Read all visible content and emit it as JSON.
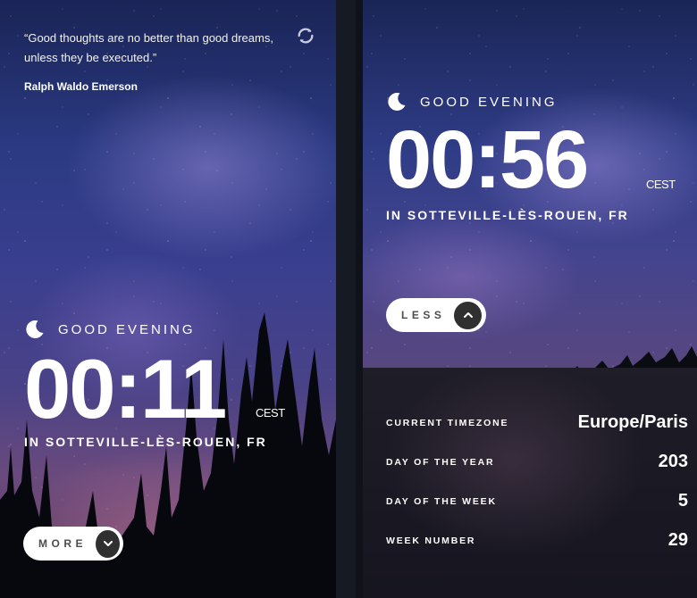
{
  "left": {
    "quote": {
      "text": "“Good thoughts are no better than good dreams, unless they be executed.”",
      "author": "Ralph Waldo Emerson"
    },
    "greeting": "GOOD EVENING",
    "time": "00:11",
    "timezone_abbr": "CEST",
    "location": "IN SOTTEVILLE-LÈS-ROUEN, FR",
    "toggle_label": "MORE"
  },
  "right": {
    "greeting": "GOOD EVENING",
    "time": "00:56",
    "timezone_abbr": "CEST",
    "location": "IN SOTTEVILLE-LÈS-ROUEN, FR",
    "toggle_label": "LESS",
    "details": [
      {
        "label": "CURRENT TIMEZONE",
        "value": "Europe/Paris"
      },
      {
        "label": "DAY OF THE YEAR",
        "value": "203"
      },
      {
        "label": "DAY OF THE WEEK",
        "value": "5"
      },
      {
        "label": "WEEK NUMBER",
        "value": "29"
      }
    ]
  },
  "icons": {
    "refresh": "refresh-icon",
    "moon": "moon-icon",
    "chevron_down": "chevron-down-icon",
    "chevron_up": "chevron-up-icon"
  },
  "colors": {
    "button_bg": "#ffffff",
    "button_circle": "#303030",
    "button_text": "#4d4d4d",
    "details_bg": "#1c1a24"
  }
}
